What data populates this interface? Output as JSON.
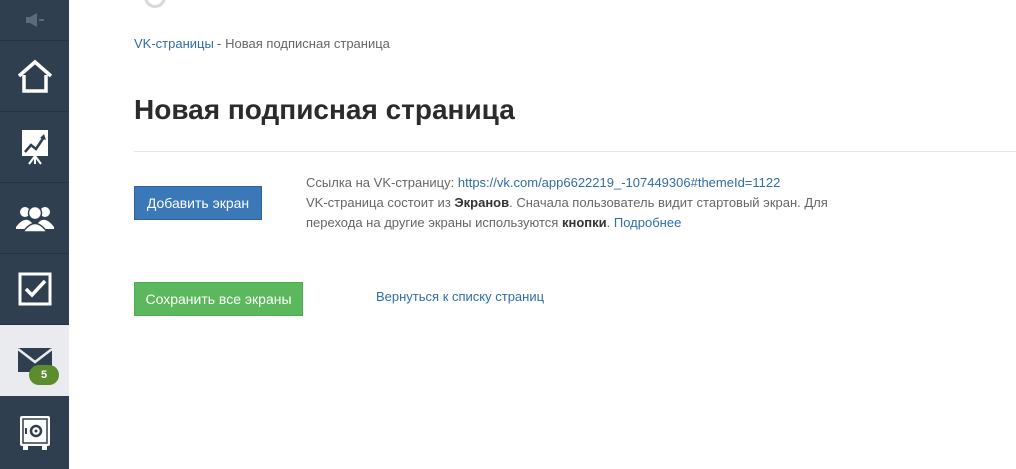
{
  "sidebar": {
    "items": [
      {
        "name": "megaphone-icon"
      },
      {
        "name": "home-icon"
      },
      {
        "name": "chart-board-icon"
      },
      {
        "name": "users-icon"
      },
      {
        "name": "checkbox-icon"
      },
      {
        "name": "envelope-icon",
        "active": true,
        "badge": "5"
      },
      {
        "name": "safe-icon"
      }
    ],
    "colors": {
      "bg": "#2f3f4f",
      "active_bg": "#e9ebee",
      "badge_bg": "#5b8d2e"
    }
  },
  "breadcrumb": {
    "parent": "VK-страницы",
    "separator": "-",
    "current": "Новая подписная страница"
  },
  "page": {
    "title": "Новая подписная страница"
  },
  "actions": {
    "add_screen_label": "Добавить экран",
    "save_all_label": "Сохранить все экраны",
    "back_link_label": "Вернуться к списку страниц"
  },
  "info": {
    "link_prefix": "Ссылка на VK-страницу:",
    "link_url": "https://vk.com/app6622219_-107449306#themeId=1122",
    "text_1": "VK-страница состоит из",
    "bold_1": "Экранов",
    "text_2": ". Сначала пользователь видит стартовый экран. Для перехода на другие экраны используются",
    "bold_2": "кнопки",
    "text_3": ".",
    "more_link": "Подробнее"
  },
  "colors": {
    "link": "#2f6ea9",
    "primary_button": "#3a78b7",
    "success_button": "#5cb85c"
  }
}
